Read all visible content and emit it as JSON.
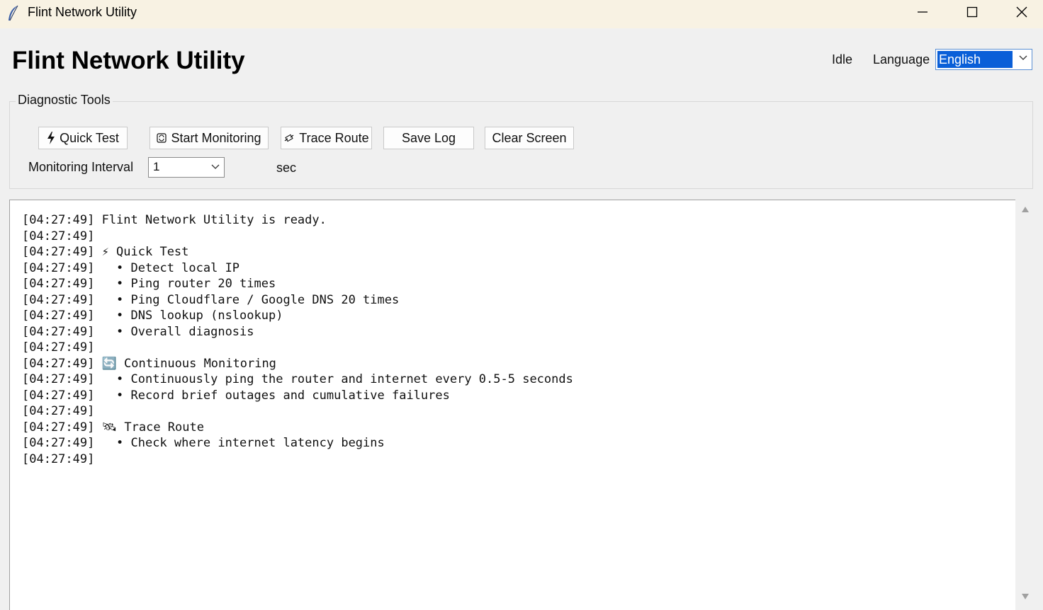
{
  "window": {
    "title": "Flint Network Utility",
    "controls": [
      "minimize-icon",
      "maximize-icon",
      "close-icon"
    ]
  },
  "header": {
    "app_title": "Flint Network Utility",
    "status": "Idle",
    "language_label": "Language",
    "language_value": "English"
  },
  "tools": {
    "group_label": "Diagnostic Tools",
    "buttons": {
      "quick_test": "Quick Test",
      "start_monitoring": "Start Monitoring",
      "trace_route": "Trace Route",
      "save_log": "Save Log",
      "clear_screen": "Clear Screen"
    },
    "interval_label": "Monitoring Interval",
    "interval_value": "1",
    "interval_unit": "sec"
  },
  "log": {
    "lines": [
      "[04:27:49] Flint Network Utility is ready.",
      "[04:27:49]",
      "[04:27:49] ⚡ Quick Test",
      "[04:27:49]   • Detect local IP",
      "[04:27:49]   • Ping router 20 times",
      "[04:27:49]   • Ping Cloudflare / Google DNS 20 times",
      "[04:27:49]   • DNS lookup (nslookup)",
      "[04:27:49]   • Overall diagnosis",
      "[04:27:49]",
      "[04:27:49] 🔄 Continuous Monitoring",
      "[04:27:49]   • Continuously ping the router and internet every 0.5-5 seconds",
      "[04:27:49]   • Record brief outages and cumulative failures",
      "[04:27:49]",
      "[04:27:49] 🛰 Trace Route",
      "[04:27:49]   • Check where internet latency begins",
      "[04:27:49]"
    ]
  },
  "colors": {
    "titlebar_bg": "#f8f2e3",
    "window_bg": "#f0f0f0",
    "select_highlight": "#0a5fd8"
  }
}
